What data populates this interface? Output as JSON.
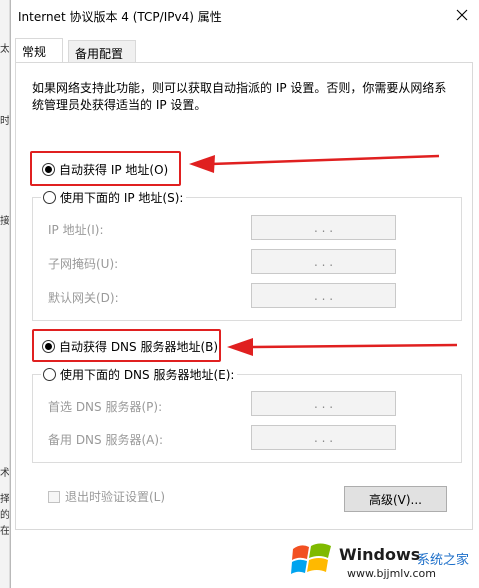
{
  "window": {
    "title": "Internet 协议版本 4 (TCP/IPv4) 属性"
  },
  "tabs": [
    {
      "label": "常规",
      "active": true
    },
    {
      "label": "备用配置",
      "active": false
    }
  ],
  "description": "如果网络支持此功能，则可以获取自动指派的 IP 设置。否则，你需要从网络系统管理员处获得适当的 IP 设置。",
  "ip_section": {
    "auto_option": {
      "label": "自动获得 IP 地址(O)",
      "selected": true
    },
    "manual_option": {
      "label": "使用下面的 IP 地址(S):",
      "selected": false
    },
    "fields": [
      {
        "label": "IP 地址(I):",
        "value": ". . ."
      },
      {
        "label": "子网掩码(U):",
        "value": ". . ."
      },
      {
        "label": "默认网关(D):",
        "value": ". . ."
      }
    ]
  },
  "dns_section": {
    "auto_option": {
      "label": "自动获得 DNS 服务器地址(B)",
      "selected": true
    },
    "manual_option": {
      "label": "使用下面的 DNS 服务器地址(E):",
      "selected": false
    },
    "fields": [
      {
        "label": "首选 DNS 服务器(P):",
        "value": ". . ."
      },
      {
        "label": "备用 DNS 服务器(A):",
        "value": ". . ."
      }
    ]
  },
  "validate_checkbox": {
    "label": "退出时验证设置(L)",
    "checked": false
  },
  "advanced_button": {
    "label": "高级(V)..."
  },
  "background_fragments": [
    "太",
    "时",
    "接",
    "术",
    "择",
    "的",
    "在"
  ],
  "watermark": {
    "brand": "Windows",
    "site": "系统之家",
    "url": "www.bjjmlv.com"
  },
  "colors": {
    "highlight": "#e02020",
    "disabled_text": "#9a9a9a",
    "button_face": "#e1e1e1",
    "watermark_blue": "#1d6fc9"
  }
}
